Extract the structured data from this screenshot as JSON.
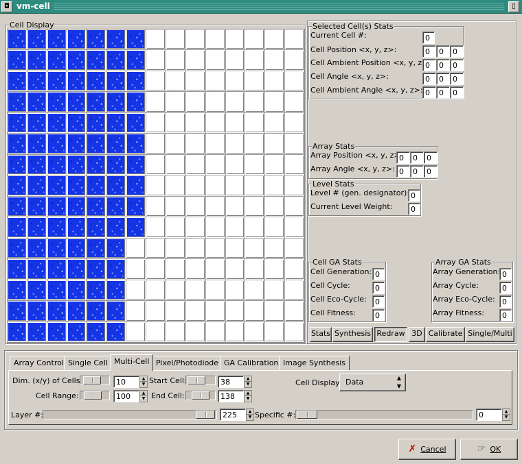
{
  "window": {
    "title": "vm-cell"
  },
  "cell_display": {
    "legend": "Cell Display",
    "rows": 15,
    "cols": 15,
    "filled_per_row": [
      7,
      7,
      7,
      7,
      7,
      7,
      7,
      7,
      7,
      7,
      6,
      6,
      6,
      6,
      6
    ]
  },
  "selected": {
    "legend": "Selected Cell(s) Stats",
    "current_cell_label": "Current Cell #:",
    "current_cell": "0",
    "position_label": "Cell Position <x, y, z>:",
    "position": [
      "0",
      "0",
      "0"
    ],
    "ambient_position_label": "Cell Ambient Position <x, y, z>:",
    "ambient_position": [
      "0",
      "0",
      "0"
    ],
    "angle_label": "Cell Angle <x, y, z>:",
    "angle": [
      "0",
      "0",
      "0"
    ],
    "ambient_angle_label": "Cell Ambient Angle <x, y, z>:",
    "ambient_angle": [
      "0",
      "0",
      "0"
    ]
  },
  "array_stats": {
    "legend": "Array Stats",
    "position_label": "Array Position <x, y, z>:",
    "position": [
      "0",
      "0",
      "0"
    ],
    "angle_label": "Array Angle <x, y, z>:",
    "angle": [
      "0",
      "0",
      "0"
    ]
  },
  "level_stats": {
    "legend": "Level Stats",
    "level_label": "Level # (gen. designator):",
    "level": "0",
    "weight_label": "Current Level Weight:",
    "weight": "0"
  },
  "cell_ga": {
    "legend": "Cell GA Stats",
    "generation_label": "Cell Generation:",
    "generation": "0",
    "cycle_label": "Cell Cycle:",
    "cycle": "0",
    "eco_label": "Cell Eco-Cycle:",
    "eco": "0",
    "fitness_label": "Cell Fitness:",
    "fitness": "0"
  },
  "array_ga": {
    "legend": "Array GA Stats",
    "generation_label": "Array Generation:",
    "generation": "0",
    "cycle_label": "Array Cycle:",
    "cycle": "0",
    "eco_label": "Array Eco-Cycle:",
    "eco": "0",
    "fitness_label": "Array Fitness:",
    "fitness": "0"
  },
  "view_buttons": [
    "Stats",
    "Synthesis",
    "Redraw",
    "3D",
    "Calibrate",
    "Single/Multi"
  ],
  "tabs": [
    "Array Control",
    "Single Cell",
    "Multi-Cell",
    "Pixel/Photodiode",
    "GA Calibration",
    "Image Synthesis"
  ],
  "active_tab": "Multi-Cell",
  "multi_cell": {
    "dim_label": "Dim. (x/y) of Cells:",
    "dim_value": "10",
    "range_label": "Cell Range:",
    "range_value": "100",
    "start_label": "Start Cell:",
    "start_value": "38",
    "end_label": "End Cell:",
    "end_value": "138",
    "display_label": "Cell Display:",
    "display_value": "Data",
    "layer_label": "Layer #:",
    "layer_value": "225",
    "specific_label": "Specific #:",
    "specific_value": "0"
  },
  "dialog": {
    "cancel_label": "Cancel",
    "ok_label": "OK"
  }
}
